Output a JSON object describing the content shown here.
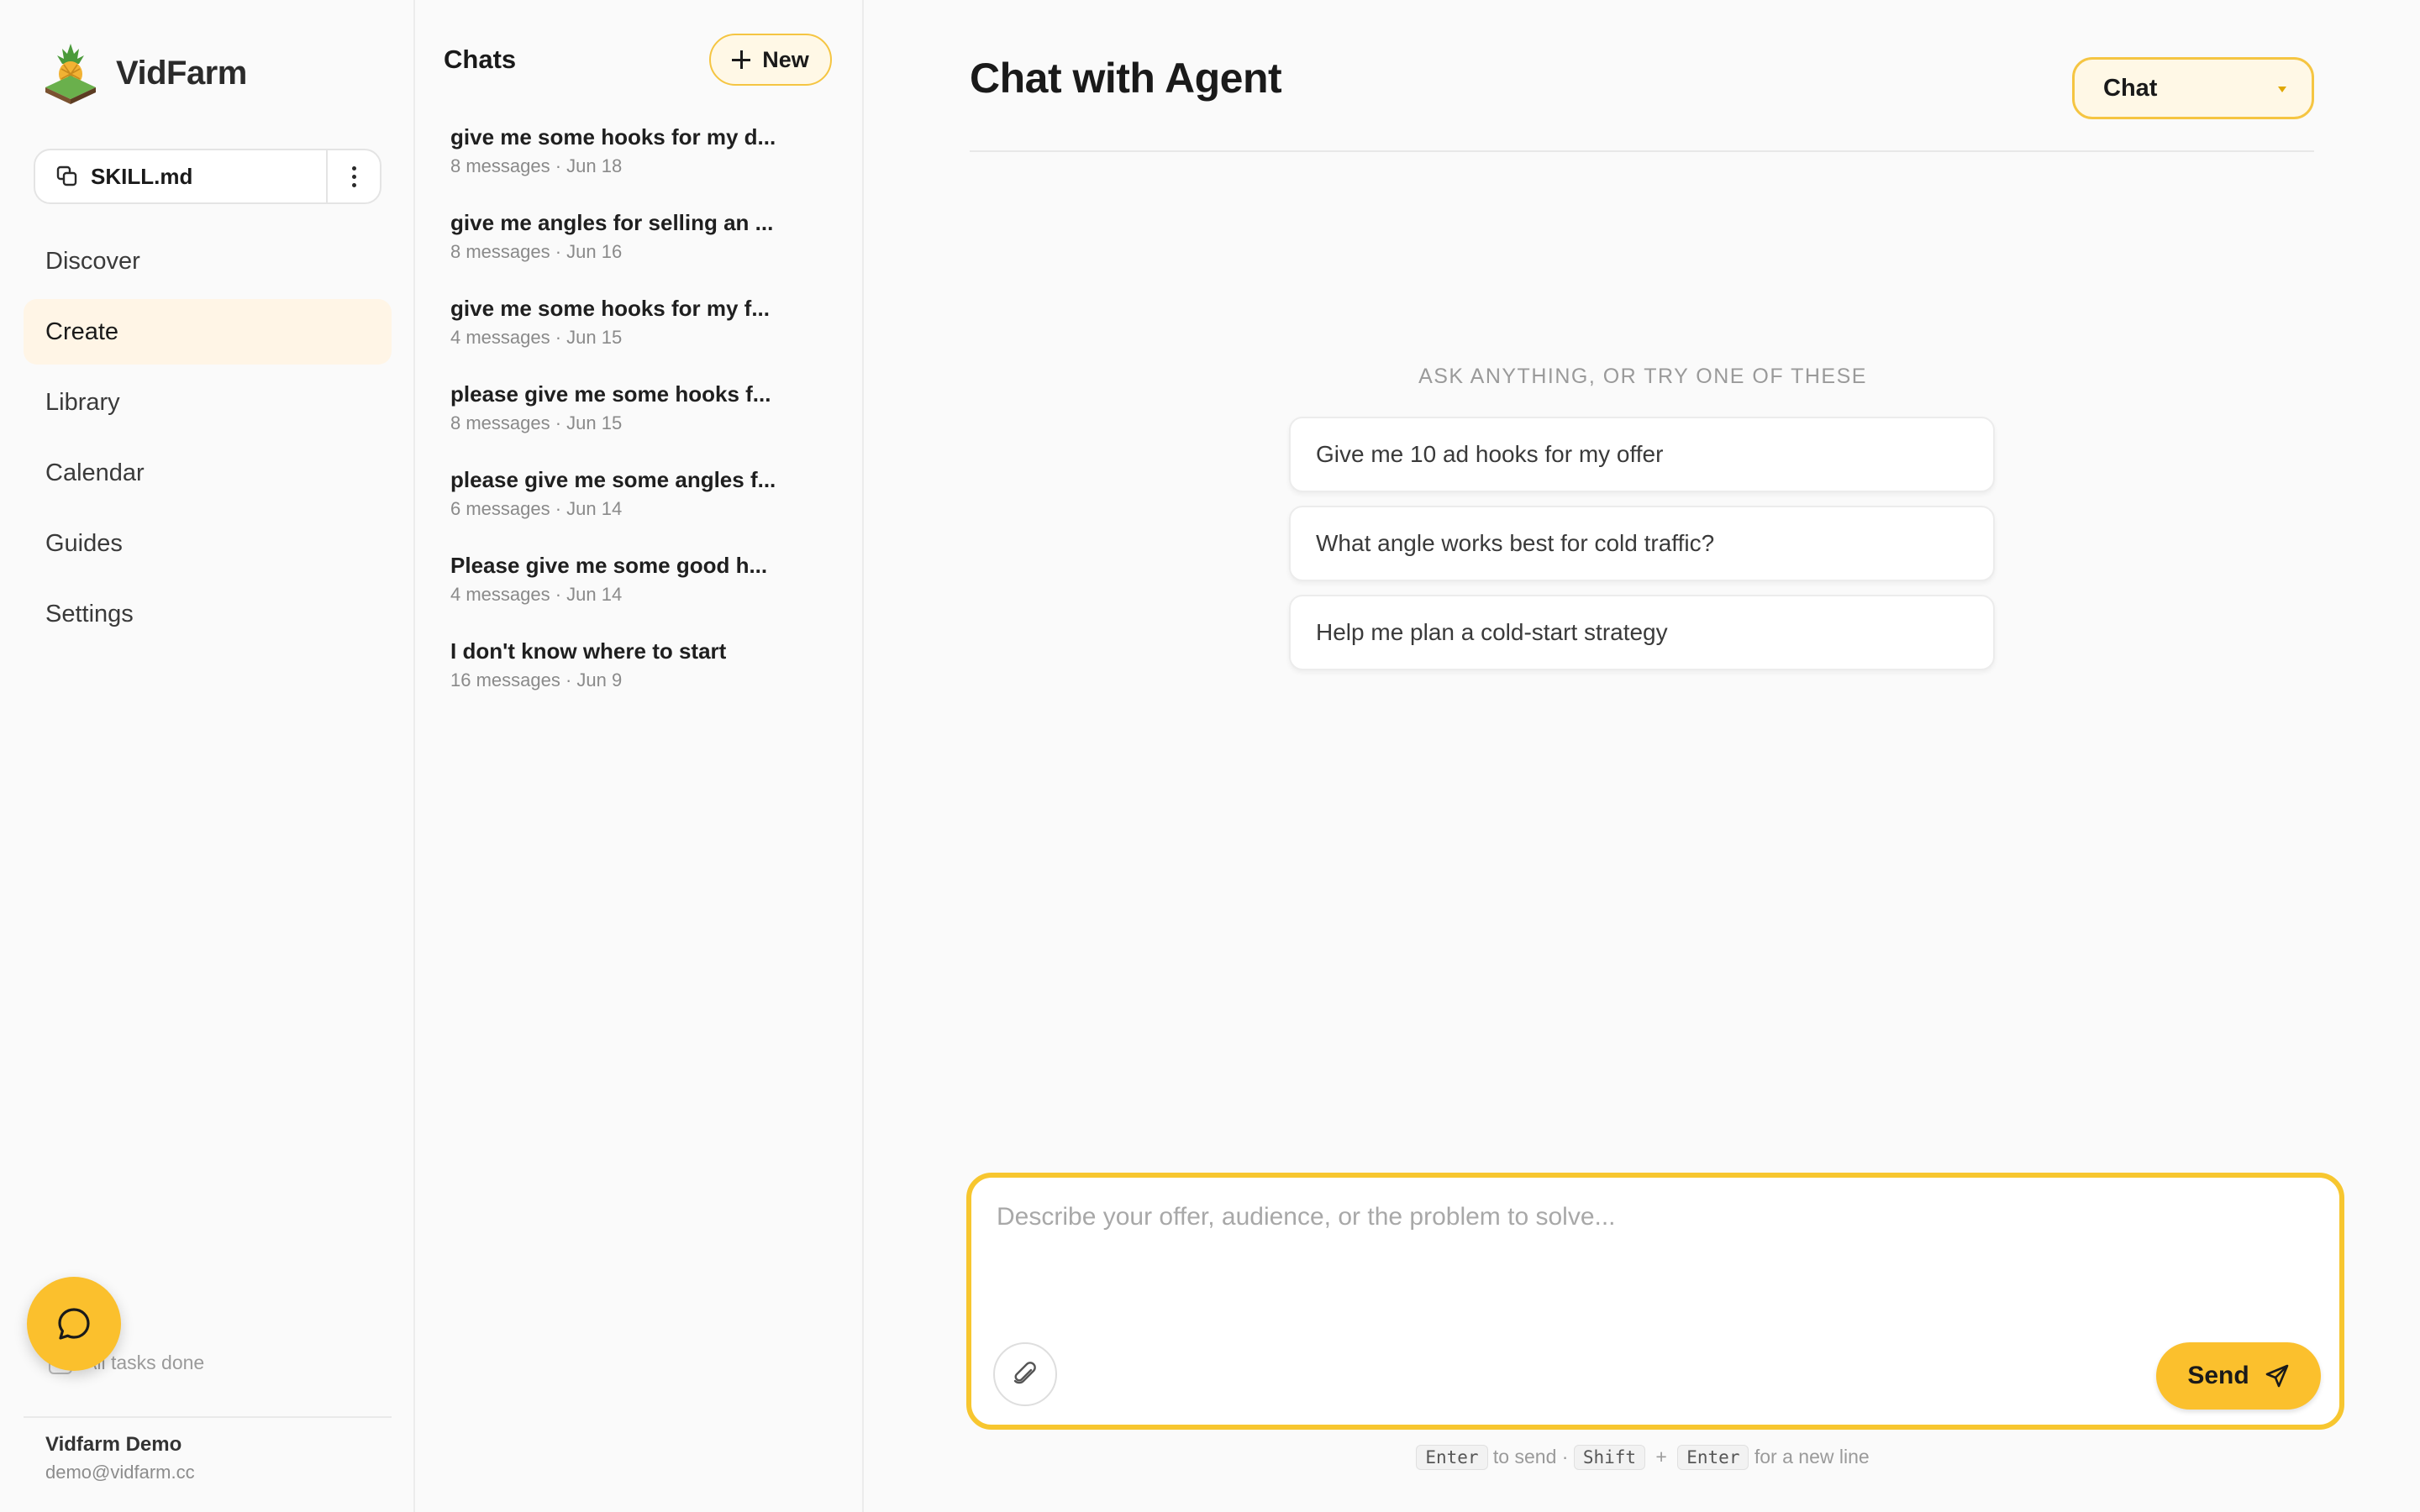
{
  "brand": {
    "name": "VidFarm"
  },
  "skill": {
    "label": "SKILL.md"
  },
  "nav": {
    "items": [
      {
        "label": "Discover",
        "active": false
      },
      {
        "label": "Create",
        "active": true
      },
      {
        "label": "Library",
        "active": false
      },
      {
        "label": "Calendar",
        "active": false
      },
      {
        "label": "Guides",
        "active": false
      },
      {
        "label": "Settings",
        "active": false
      }
    ]
  },
  "tasks": {
    "label": "All tasks done"
  },
  "user": {
    "name": "Vidfarm Demo",
    "email": "demo@vidfarm.cc"
  },
  "chats": {
    "title": "Chats",
    "new_label": "New",
    "items": [
      {
        "title": "give me some hooks for my d...",
        "meta": "8 messages · Jun 18"
      },
      {
        "title": "give me angles for selling an ...",
        "meta": "8 messages · Jun 16"
      },
      {
        "title": "give me some hooks for my f...",
        "meta": "4 messages · Jun 15"
      },
      {
        "title": "please give me some hooks f...",
        "meta": "8 messages · Jun 15"
      },
      {
        "title": "please give me some angles f...",
        "meta": "6 messages · Jun 14"
      },
      {
        "title": "Please give me some good h...",
        "meta": "4 messages · Jun 14"
      },
      {
        "title": "I don't know where to start",
        "meta": "16 messages · Jun 9"
      }
    ]
  },
  "main": {
    "title": "Chat with Agent",
    "mode": "Chat",
    "suggest_heading": "ASK ANYTHING, OR TRY ONE OF THESE",
    "suggestions": [
      "Give me 10 ad hooks for my offer",
      "What angle works best for cold traffic?",
      "Help me plan a cold-start strategy"
    ]
  },
  "composer": {
    "value": "",
    "placeholder": "Describe your offer, audience, or the problem to solve...",
    "send_label": "Send"
  },
  "hint": {
    "key_enter": "Enter",
    "send_text": "to send ·",
    "key_shift": "Shift",
    "plus": "+",
    "key_enter2": "Enter",
    "newline_text": "for a new line"
  },
  "colors": {
    "accent": "#fbc02d",
    "accent_border": "#f7c62f",
    "active_nav_bg": "#fff5e6"
  },
  "icons": {
    "logo": "pineapple-logo-icon",
    "skill": "copy-icon",
    "menu": "kebab-menu-icon",
    "new": "plus-icon",
    "fab": "chat-bubble-icon",
    "attach": "paperclip-icon",
    "send": "send-arrow-icon"
  }
}
